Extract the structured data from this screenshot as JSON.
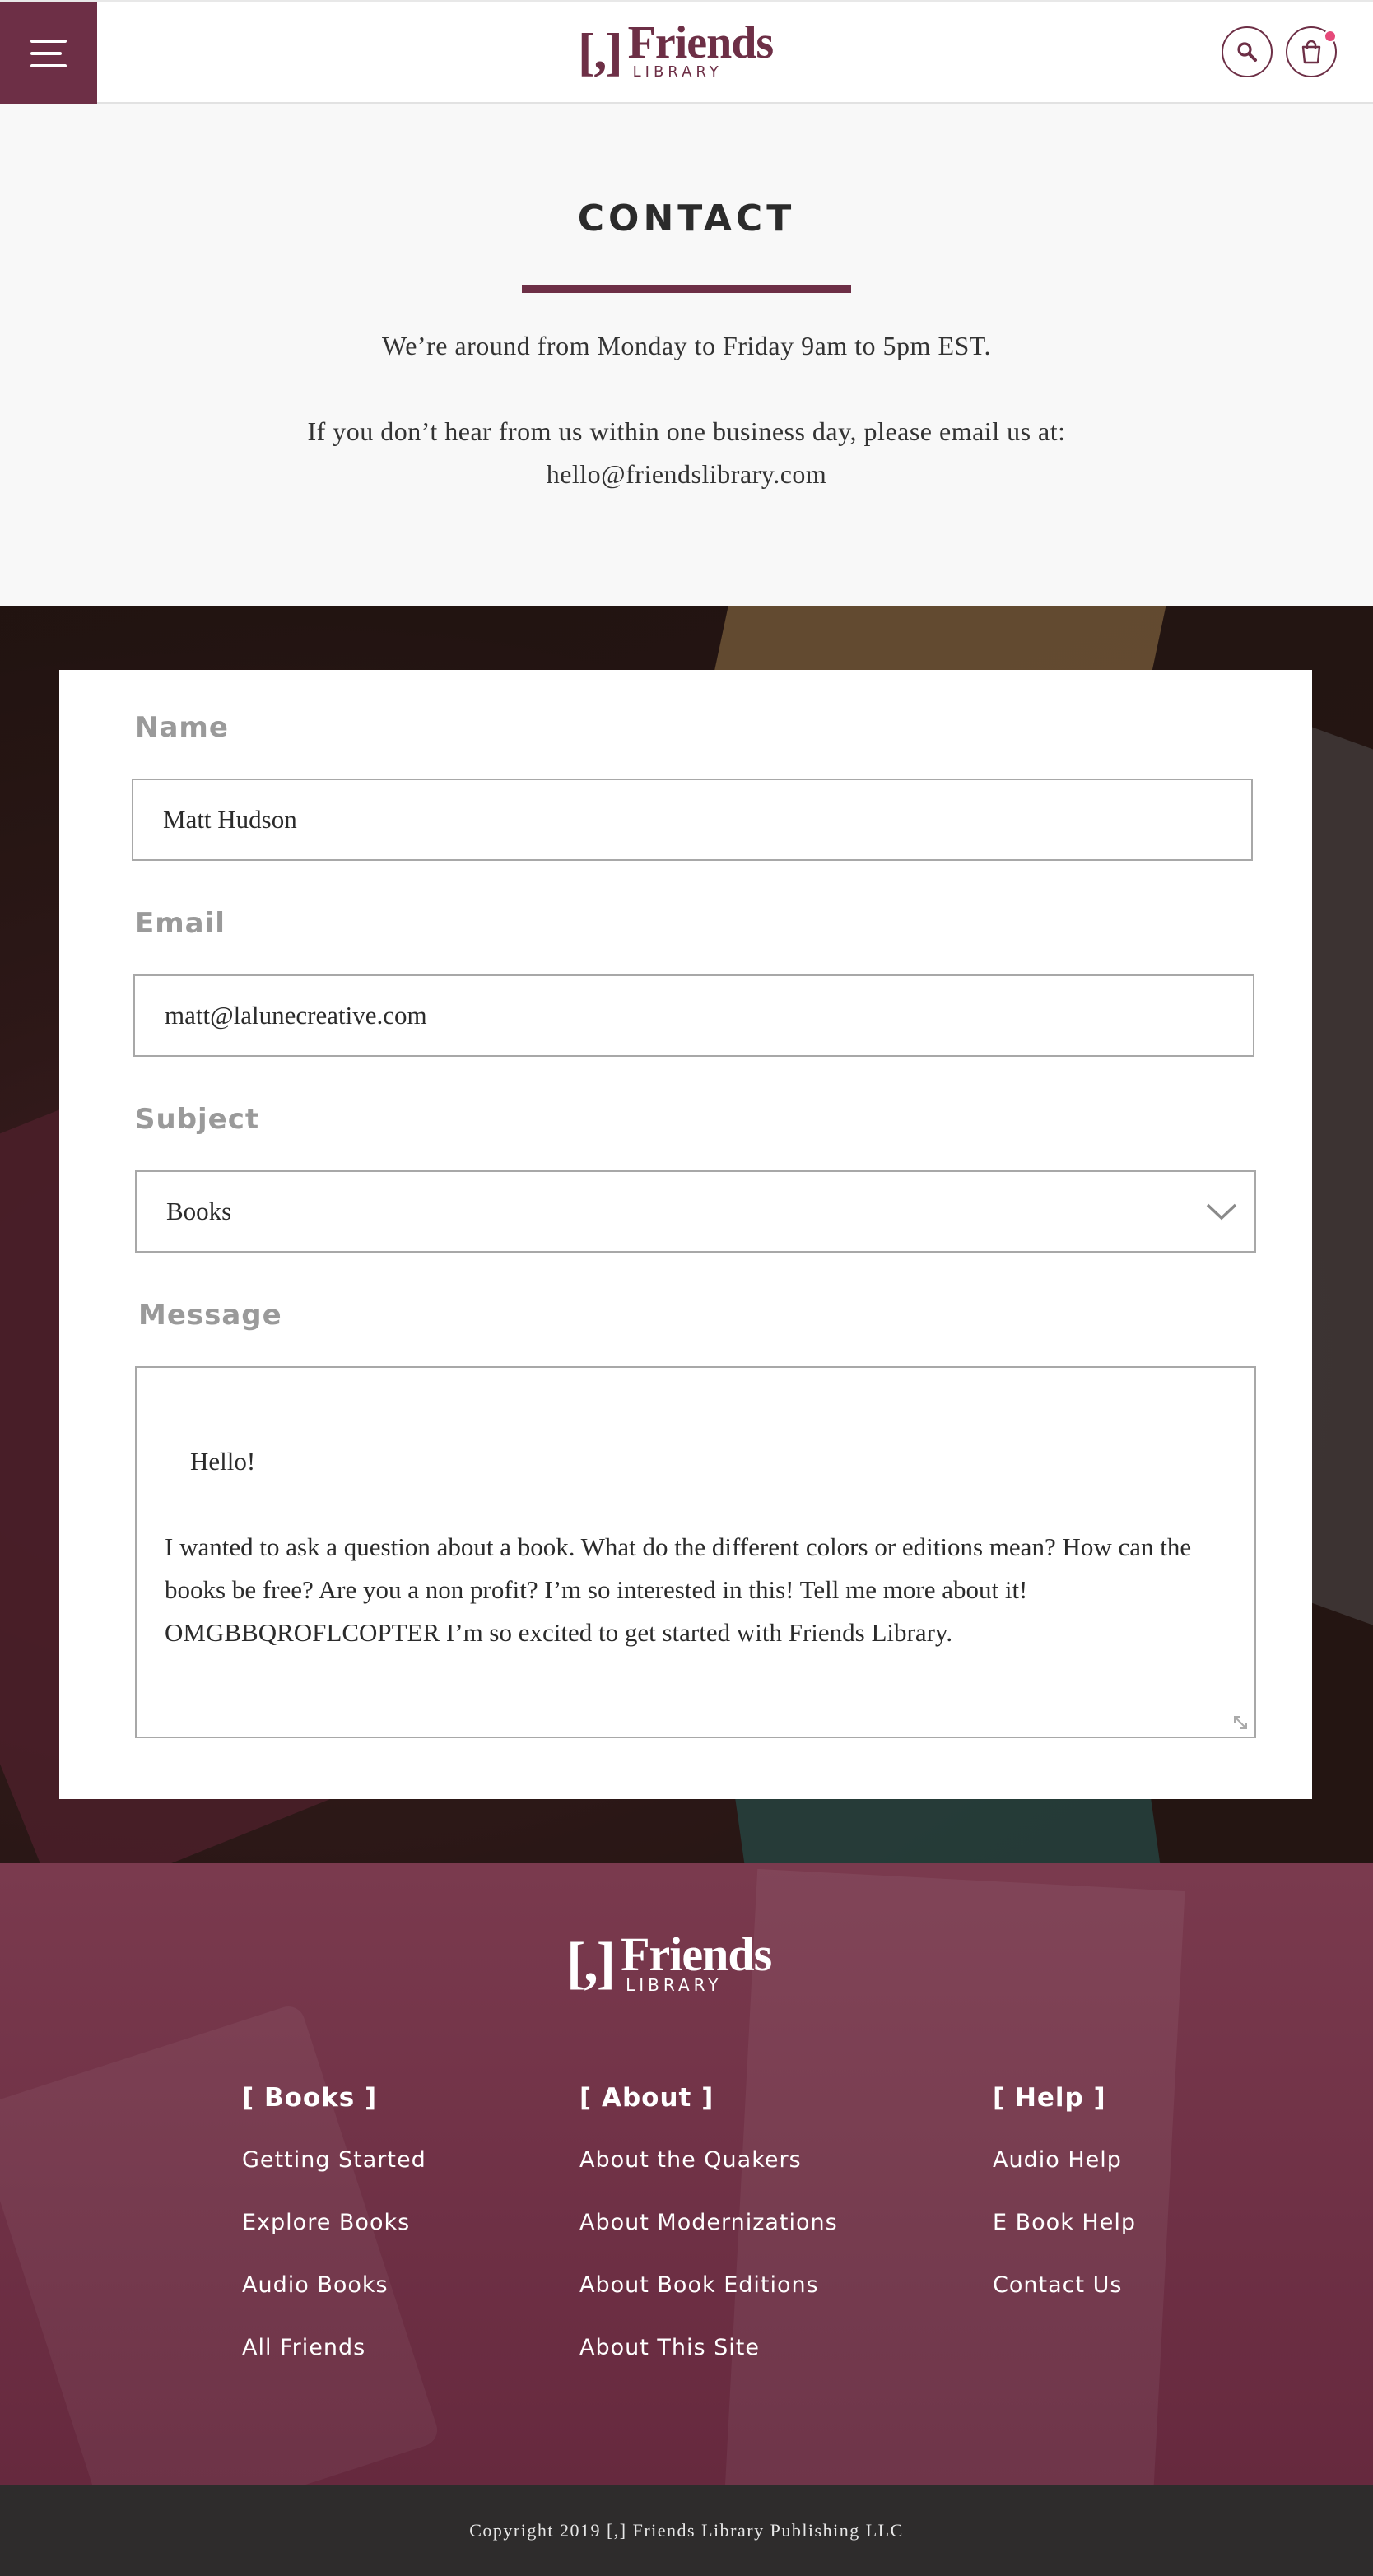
{
  "header": {
    "logo_mark": "[,]",
    "logo_title": "Friends",
    "logo_sub": "LIBRARY",
    "accent_color": "#6d2f46",
    "cart_badge_color": "#e64a7a",
    "icons": [
      "menu-icon",
      "search-icon",
      "cart-icon"
    ]
  },
  "intro": {
    "title": "CONTACT",
    "hours": "We’re around from Monday to Friday 9am to 5pm EST.",
    "followup": "If you don’t hear from us within one business day, please email us at:",
    "email": "hello@friendslibrary.com"
  },
  "form": {
    "name_label": "Name",
    "name_value": "Matt Hudson",
    "email_label": "Email",
    "email_value": "matt@lalunecreative.com",
    "subject_label": "Subject",
    "subject_value": "Books",
    "message_label": "Message",
    "message_value": "Hello!\n\nI wanted to ask a question about a book. What do the different colors or editions mean? How can the books be free? Are you a non profit? I’m so interested in this! Tell me more about it! OMGBBQROFLCOPTER I’m so excited to get started with Friends Library."
  },
  "footer": {
    "logo_mark": "[,]",
    "logo_title": "Friends",
    "logo_sub": "LIBRARY",
    "columns": [
      {
        "heading": "[ Books ]",
        "links": [
          "Getting Started",
          "Explore Books",
          "Audio Books",
          "All Friends"
        ]
      },
      {
        "heading": "[ About ]",
        "links": [
          "About the Quakers",
          "About Modernizations",
          "About Book Editions",
          "About This Site"
        ]
      },
      {
        "heading": "[ Help ]",
        "links": [
          "Audio Help",
          "E Book Help",
          "Contact Us"
        ]
      }
    ],
    "copyright": "Copyright 2019 [,] Friends Library Publishing LLC"
  }
}
